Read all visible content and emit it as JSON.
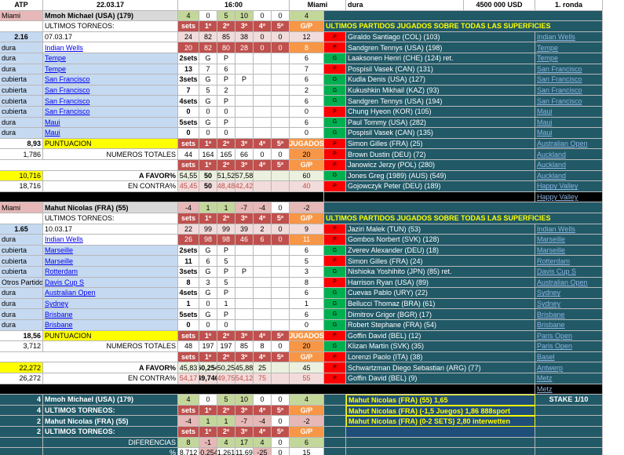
{
  "header": {
    "tour": "ATP",
    "date": "22.03.17",
    "time": "16:00",
    "city": "Miami",
    "surface": "dura",
    "prize": "4500 000 USD",
    "round": "1. ronda"
  },
  "recent_title": "ULTIMOS PARTIDOS JUGADOS SOBRE TODAS LAS  SUPERFICIES",
  "labels": {
    "ultimos": "ULTIMOS TORNEOS:",
    "puntuacion": "PUNTUACION",
    "numeros": "NUMEROS TOTALES",
    "afavor": "A FAVOR%",
    "encontra": "EN CONTRA%",
    "diferencias": "DIFERENCIAS",
    "pct": "%",
    "stake": "STAKE 1/10"
  },
  "hdr_cols": [
    "sets",
    "1º",
    "2º",
    "3º",
    "4º",
    "5º",
    "G/P"
  ],
  "hdr_cols_jug": [
    "sets",
    "1º",
    "2º",
    "3º",
    "4º",
    "5º",
    "JUGADOS"
  ],
  "p1": {
    "name": "Mmoh Michael (USA) (179)",
    "loc": "Miami",
    "rating": "2.16",
    "score": [
      "4",
      "0",
      "5",
      "10",
      "0",
      "0",
      "4"
    ],
    "tournaments": [
      {
        "surface": "",
        "name": "07.03.17",
        "link": false,
        "c": [
          "24",
          "82",
          "85",
          "38",
          "0",
          "0",
          "12"
        ]
      },
      {
        "surface": "dura",
        "name": "Indian Wells",
        "link": true,
        "c": [
          "20",
          "82",
          "80",
          "28",
          "0",
          "0",
          "8"
        ]
      },
      {
        "surface": "dura",
        "name": "Tempe",
        "link": true,
        "c": [
          "2sets",
          "G",
          "P",
          "",
          "",
          "",
          "6"
        ]
      },
      {
        "surface": "dura",
        "name": "Tempe",
        "link": true,
        "c": [
          "13",
          "7",
          "6",
          "",
          "",
          "",
          "7"
        ]
      },
      {
        "surface": "cubierta",
        "name": "San Francisco",
        "link": true,
        "c": [
          "3sets",
          "G",
          "P",
          "P",
          "",
          "",
          "6"
        ]
      },
      {
        "surface": "cubierta",
        "name": "San Francisco",
        "link": true,
        "c": [
          "7",
          "5",
          "2",
          "",
          "",
          "",
          "2"
        ]
      },
      {
        "surface": "cubierta",
        "name": "San Francisco",
        "link": true,
        "c": [
          "4sets",
          "G",
          "P",
          "",
          "",
          "",
          "6"
        ]
      },
      {
        "surface": "cubierta",
        "name": "San Francisco",
        "link": true,
        "c": [
          "0",
          "0",
          "0",
          "",
          "",
          "",
          "0"
        ]
      },
      {
        "surface": "dura",
        "name": "Maui",
        "link": true,
        "c": [
          "5sets",
          "G",
          "P",
          "",
          "",
          "",
          "6"
        ]
      },
      {
        "surface": "dura",
        "name": "Maui",
        "link": true,
        "c": [
          "0",
          "0",
          "0",
          "",
          "",
          "",
          "0"
        ]
      }
    ],
    "punt": "8,93",
    "numtot": "1,786",
    "nums": [
      "44",
      "164",
      "165",
      "66",
      "0",
      "0",
      "20"
    ],
    "fav_lbl": "10,716",
    "fav": [
      "54,55",
      "50",
      "51,52",
      "57,58",
      "",
      "",
      "60"
    ],
    "con_lbl": "18,716",
    "con": [
      "45,45",
      "50",
      "48,48",
      "42,42",
      "",
      "",
      "40"
    ],
    "matches": [
      {
        "r": "P",
        "t": "Giraldo Santiago (COL) (103)",
        "tour": "Indian Wells"
      },
      {
        "r": "P",
        "t": "Sandgren Tennys (USA) (198)",
        "tour": "Tempe"
      },
      {
        "r": "G",
        "t": "Laaksonen Henri (CHE) (124) ret.",
        "tour": "Tempe"
      },
      {
        "r": "P",
        "t": "Pospisil Vasek (CAN) (131)",
        "tour": "San Francisco"
      },
      {
        "r": "G",
        "t": "Kudla Denis (USA) (127)",
        "tour": "San Francisco"
      },
      {
        "r": "G",
        "t": "Kukushkin Mikhail (KAZ) (93)",
        "tour": "San Francisco"
      },
      {
        "r": "G",
        "t": "Sandgren Tennys (USA) (194)",
        "tour": "San Francisco"
      },
      {
        "r": "P",
        "t": "Chung Hyeon (KOR) (105)",
        "tour": "Maui"
      },
      {
        "r": "G",
        "t": "Paul Tommy (USA) (282)",
        "tour": "Maui"
      },
      {
        "r": "G",
        "t": "Pospisil Vasek (CAN) (135)",
        "tour": "Maui"
      },
      {
        "r": "P",
        "t": "Simon Gilles (FRA) (25)",
        "tour": "Australian Open"
      },
      {
        "r": "P",
        "t": "Brown Dustin (DEU) (72)",
        "tour": "Auckland"
      },
      {
        "r": "P",
        "t": "Janowicz Jerzy (POL) (280)",
        "tour": "Auckland"
      },
      {
        "r": "G",
        "t": "Jones Greg (1989) (AUS) (549)",
        "tour": "Auckland"
      },
      {
        "r": "P",
        "t": "Gojowczyk Peter (DEU) (189)",
        "tour": "Happy Valley"
      }
    ],
    "extra_link": "Happy Valley"
  },
  "p2": {
    "name": "Mahut Nicolas (FRA) (55)",
    "loc": "Miami",
    "rating": "1.65",
    "score": [
      "-4",
      "1",
      "1",
      "-7",
      "-4",
      "0",
      "-2"
    ],
    "tournaments": [
      {
        "surface": "",
        "name": "10.03.17",
        "link": false,
        "c": [
          "22",
          "99",
          "99",
          "39",
          "2",
          "0",
          "9"
        ]
      },
      {
        "surface": "dura",
        "name": "Indian Wells",
        "link": true,
        "c": [
          "26",
          "98",
          "98",
          "46",
          "6",
          "0",
          "11"
        ]
      },
      {
        "surface": "cubierta",
        "name": "Marseille",
        "link": true,
        "c": [
          "2sets",
          "G",
          "P",
          "",
          "",
          "",
          "6"
        ]
      },
      {
        "surface": "cubierta",
        "name": "Marseille",
        "link": true,
        "c": [
          "11",
          "6",
          "5",
          "",
          "",
          "",
          "5"
        ]
      },
      {
        "surface": "cubierta",
        "name": "Rotterdam",
        "link": true,
        "c": [
          "3sets",
          "G",
          "P",
          "P",
          "",
          "",
          "3"
        ]
      },
      {
        "surface": "Otros Partidos",
        "name": "Davis Cup S",
        "link": true,
        "c": [
          "8",
          "3",
          "5",
          "",
          "",
          "",
          "8"
        ]
      },
      {
        "surface": "dura",
        "name": "Australian Open",
        "link": true,
        "c": [
          "4sets",
          "G",
          "P",
          "",
          "",
          "",
          "6"
        ]
      },
      {
        "surface": "dura",
        "name": "Sydney",
        "link": true,
        "c": [
          "1",
          "0",
          "1",
          "",
          "",
          "",
          "1"
        ]
      },
      {
        "surface": "dura",
        "name": "Brisbane",
        "link": true,
        "c": [
          "5sets",
          "G",
          "P",
          "",
          "",
          "",
          "6"
        ]
      },
      {
        "surface": "dura",
        "name": "Brisbane",
        "link": true,
        "c": [
          "0",
          "0",
          "0",
          "",
          "",
          "",
          "0"
        ]
      }
    ],
    "punt": "18,56",
    "numtot": "3,712",
    "nums": [
      "48",
      "197",
      "197",
      "85",
      "8",
      "0",
      "20"
    ],
    "fav_lbl": "22,272",
    "fav": [
      "45,83",
      "50,254",
      "50,25",
      "45,88",
      "25",
      "",
      "45"
    ],
    "con_lbl": "26,272",
    "con": [
      "54,17",
      "49,746",
      "49,75",
      "54,12",
      "75",
      "",
      "55"
    ],
    "matches": [
      {
        "r": "P",
        "t": "Jaziri Malek (TUN) (53)",
        "tour": "Indian Wells"
      },
      {
        "r": "P",
        "t": "Gombos Norbert (SVK) (128)",
        "tour": "Marseille"
      },
      {
        "r": "G",
        "t": "Zverev Alexander (DEU) (18)",
        "tour": "Marseille"
      },
      {
        "r": "P",
        "t": "Simon Gilles (FRA) (24)",
        "tour": "Rotterdam"
      },
      {
        "r": "G",
        "t": "Nishioka Yoshihito (JPN) (85) ret.",
        "tour": "Davis Cup S"
      },
      {
        "r": "P",
        "t": "Harrison Ryan (USA) (89)",
        "tour": "Australian Open"
      },
      {
        "r": "G",
        "t": "Cuevas Pablo (URY) (22)",
        "tour": "Sydney"
      },
      {
        "r": "G",
        "t": "Bellucci Thomaz (BRA) (61)",
        "tour": "Sydney"
      },
      {
        "r": "G",
        "t": "Dimitrov Grigor (BGR) (17)",
        "tour": "Brisbane"
      },
      {
        "r": "G",
        "t": "Robert Stephane (FRA) (54)",
        "tour": "Brisbane"
      },
      {
        "r": "P",
        "t": "Goffin David (BEL) (12)",
        "tour": "Paris Open"
      },
      {
        "r": "G",
        "t": "Klizan Martin (SVK) (35)",
        "tour": "Paris Open"
      },
      {
        "r": "P",
        "t": "Lorenzi Paolo (ITA) (38)",
        "tour": "Basel"
      },
      {
        "r": "P",
        "t": "Schwartzman Diego Sebastian (ARG) (77)",
        "tour": "Antwerp"
      },
      {
        "r": "P",
        "t": "Goffin David (BEL) (9)",
        "tour": "Metz"
      }
    ],
    "extra_link": "Metz"
  },
  "summary": [
    {
      "n": "4",
      "label": "Mmoh Michael (USA) (179)",
      "c": [
        "4",
        "0",
        "5",
        "10",
        "0",
        "0",
        "4"
      ]
    },
    {
      "n": "4",
      "label": "ULTIMOS TORNEOS:",
      "c": [
        "sets",
        "1º",
        "2º",
        "3º",
        "4º",
        "5º",
        "G/P"
      ]
    },
    {
      "n": "2",
      "label": "Mahut Nicolas (FRA) (55)",
      "c": [
        "-4",
        "1",
        "1",
        "-7",
        "-4",
        "0",
        "-2"
      ]
    },
    {
      "n": "2",
      "label": "ULTIMOS TORNEOS:",
      "c": [
        "sets",
        "1º",
        "2º",
        "3º",
        "4º",
        "5º",
        "G/P"
      ]
    },
    {
      "n": "",
      "label": "DIFERENCIAS",
      "c": [
        "8",
        "-1",
        "4",
        "17",
        "4",
        "0",
        "6"
      ]
    },
    {
      "n": "",
      "label": "%",
      "c": [
        "8,712",
        "-0,254",
        "1,261",
        "11,69",
        "-25",
        "0",
        "15"
      ]
    }
  ],
  "bets": [
    "Mahut Nicolas (FRA) (55) 1,65",
    "Mahut Nicolas (FRA) (-1,5 Juegos) 1,86 888sport",
    "Mahut Nicolas (FRA) (0-2 SETS) 2,80 interwetten"
  ]
}
